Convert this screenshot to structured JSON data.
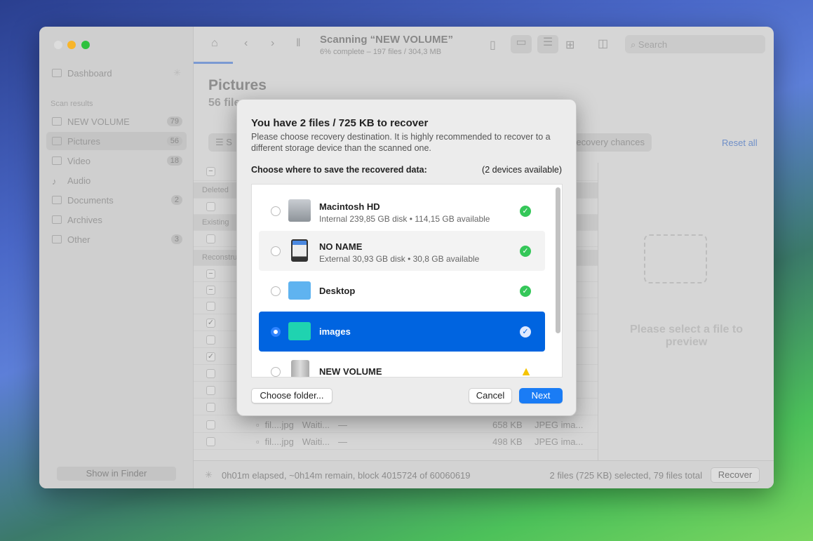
{
  "toolbar": {
    "title": "Scanning “NEW VOLUME”",
    "subtitle": "6% complete – 197 files / 304,3 MB",
    "search_placeholder": "Search"
  },
  "sidebar": {
    "dashboard": "Dashboard",
    "section": "Scan results",
    "items": [
      {
        "label": "NEW VOLUME",
        "count": "79"
      },
      {
        "label": "Pictures",
        "count": "56"
      },
      {
        "label": "Video",
        "count": "18"
      },
      {
        "label": "Audio",
        "count": ""
      },
      {
        "label": "Documents",
        "count": "2"
      },
      {
        "label": "Archives",
        "count": ""
      },
      {
        "label": "Other",
        "count": "3"
      }
    ],
    "show_in_finder": "Show in Finder"
  },
  "main": {
    "title": "Pictures",
    "subtitle": "56 files",
    "filter_label": "S",
    "chances_label": "Recovery chances",
    "reset_all": "Reset all",
    "groups": [
      "Deleted",
      "Existing",
      "Reconstructed"
    ],
    "rows": [
      {
        "name": "fil....jpg",
        "status": "Waiti...",
        "dash": "—",
        "size": "658 KB",
        "kind": "JPEG ima..."
      },
      {
        "name": "fil....jpg",
        "status": "Waiti...",
        "dash": "—",
        "size": "498 KB",
        "kind": "JPEG ima..."
      }
    ],
    "preview": "Please select a file to preview"
  },
  "status": {
    "progress": "0h01m elapsed, ~0h14m remain, block 4015724 of 60060619",
    "selection": "2 files (725 KB) selected, 79 files total",
    "recover": "Recover"
  },
  "dialog": {
    "title": "You have 2 files / 725 KB to recover",
    "desc": "Please choose recovery destination. It is highly recommended to recover to a different storage device than the scanned one.",
    "choose_label": "Choose where to save the recovered data:",
    "devices": "(2 devices available)",
    "items": [
      {
        "name": "Macintosh HD",
        "sub": "Internal 239,85 GB disk • 114,15 GB available",
        "status": "ok"
      },
      {
        "name": "NO NAME",
        "sub": "External 30,93 GB disk • 30,8 GB available",
        "status": "ok"
      },
      {
        "name": "Desktop",
        "sub": "",
        "status": "ok"
      },
      {
        "name": "images",
        "sub": "",
        "status": "selected"
      },
      {
        "name": "NEW VOLUME",
        "sub": "",
        "status": "warning"
      }
    ],
    "choose_folder": "Choose folder...",
    "cancel": "Cancel",
    "next": "Next"
  },
  "colors": {
    "accent": "#0064e0",
    "ok": "#35c759",
    "warning": "#f5c400"
  }
}
